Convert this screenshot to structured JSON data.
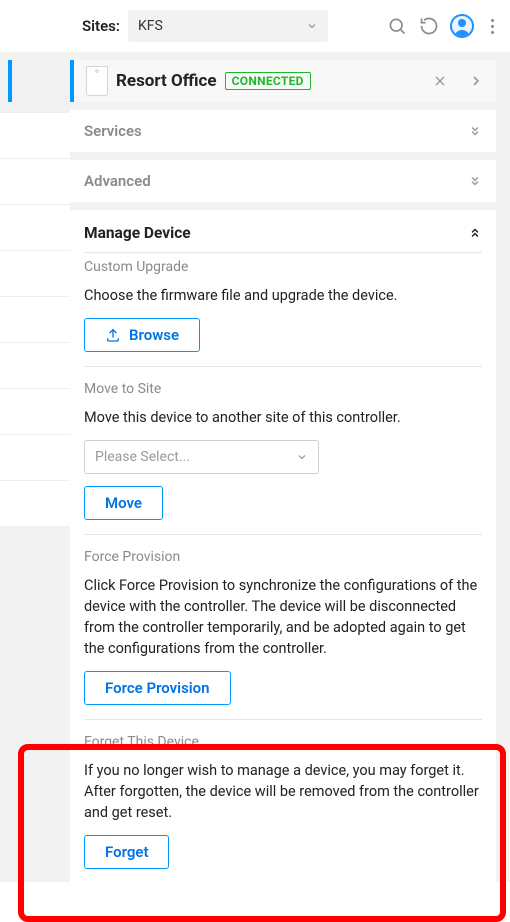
{
  "topbar": {
    "sites_label": "Sites:",
    "site_selected": "KFS"
  },
  "device_header": {
    "name": "Resort Office",
    "status": "CONNECTED"
  },
  "sections": {
    "services": {
      "title": "Services"
    },
    "advanced": {
      "title": "Advanced"
    },
    "manage": {
      "title": "Manage Device"
    }
  },
  "manage": {
    "custom_upgrade": {
      "title": "Custom Upgrade",
      "text": "Choose the firmware file and upgrade the device.",
      "browse_btn": "Browse"
    },
    "move_to_site": {
      "title": "Move to Site",
      "text": "Move this device to another site of this controller.",
      "placeholder": "Please Select...",
      "move_btn": "Move"
    },
    "force_provision": {
      "title": "Force Provision",
      "text": "Click Force Provision to synchronize the configurations of the device with the controller. The device will be disconnected from the controller temporarily, and be adopted again to get the configurations from the controller.",
      "btn": "Force Provision"
    },
    "forget": {
      "title": "Forget This Device",
      "text": "If you no longer wish to manage a device, you may forget it. After forgotten, the device will be removed from the controller and get reset.",
      "btn": "Forget"
    }
  }
}
